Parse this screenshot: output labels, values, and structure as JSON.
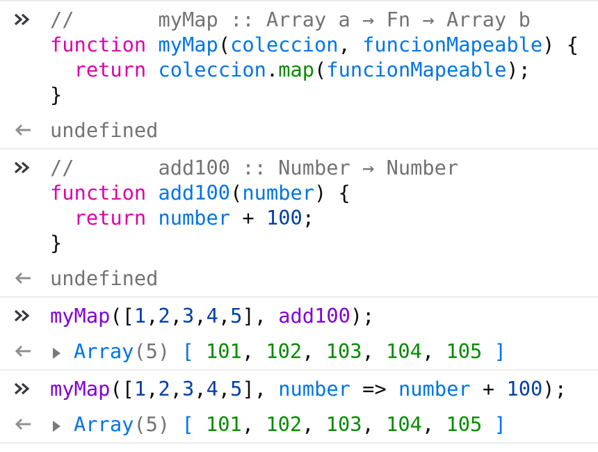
{
  "entries": [
    {
      "input": [
        [
          [
            "c-comment",
            "//       myMap :: Array a → Fn → Array b"
          ]
        ],
        [
          [
            "c-kw",
            "function"
          ],
          [
            "c-plain",
            " "
          ],
          [
            "c-fn",
            "myMap"
          ],
          [
            "c-plain",
            "("
          ],
          [
            "c-var",
            "coleccion"
          ],
          [
            "c-plain",
            ", "
          ],
          [
            "c-var",
            "funcionMapeable"
          ],
          [
            "c-plain",
            ") {"
          ]
        ],
        [
          [
            "c-plain",
            "  "
          ],
          [
            "c-kw",
            "return"
          ],
          [
            "c-plain",
            " "
          ],
          [
            "c-var",
            "coleccion"
          ],
          [
            "c-plain",
            "."
          ],
          [
            "c-prop",
            "map"
          ],
          [
            "c-plain",
            "("
          ],
          [
            "c-var",
            "funcionMapeable"
          ],
          [
            "c-plain",
            ");"
          ]
        ],
        [
          [
            "c-plain",
            "}"
          ]
        ]
      ],
      "output": {
        "type": "text",
        "text": "undefined"
      }
    },
    {
      "input": [
        [
          [
            "c-comment",
            "//       add100 :: Number → Number"
          ]
        ],
        [
          [
            "c-kw",
            "function"
          ],
          [
            "c-plain",
            " "
          ],
          [
            "c-fn",
            "add100"
          ],
          [
            "c-plain",
            "("
          ],
          [
            "c-var",
            "number"
          ],
          [
            "c-plain",
            ") {"
          ]
        ],
        [
          [
            "c-plain",
            "  "
          ],
          [
            "c-kw",
            "return"
          ],
          [
            "c-plain",
            " "
          ],
          [
            "c-var",
            "number"
          ],
          [
            "c-plain",
            " + "
          ],
          [
            "c-num",
            "100"
          ],
          [
            "c-plain",
            ";"
          ]
        ],
        [
          [
            "c-plain",
            "}"
          ]
        ]
      ],
      "output": {
        "type": "text",
        "text": "undefined"
      }
    },
    {
      "input": [
        [
          [
            "c-call",
            "myMap"
          ],
          [
            "c-plain",
            "(["
          ],
          [
            "c-num",
            "1"
          ],
          [
            "c-plain",
            ","
          ],
          [
            "c-num",
            "2"
          ],
          [
            "c-plain",
            ","
          ],
          [
            "c-num",
            "3"
          ],
          [
            "c-plain",
            ","
          ],
          [
            "c-num",
            "4"
          ],
          [
            "c-plain",
            ","
          ],
          [
            "c-num",
            "5"
          ],
          [
            "c-plain",
            "], "
          ],
          [
            "c-call",
            "add100"
          ],
          [
            "c-plain",
            ");"
          ]
        ]
      ],
      "output": {
        "type": "array",
        "label": "Array",
        "length": "(5)",
        "values": [
          "101",
          "102",
          "103",
          "104",
          "105"
        ]
      }
    },
    {
      "input": [
        [
          [
            "c-call",
            "myMap"
          ],
          [
            "c-plain",
            "(["
          ],
          [
            "c-num",
            "1"
          ],
          [
            "c-plain",
            ","
          ],
          [
            "c-num",
            "2"
          ],
          [
            "c-plain",
            ","
          ],
          [
            "c-num",
            "3"
          ],
          [
            "c-plain",
            ","
          ],
          [
            "c-num",
            "4"
          ],
          [
            "c-plain",
            ","
          ],
          [
            "c-num",
            "5"
          ],
          [
            "c-plain",
            "], "
          ],
          [
            "c-var",
            "number"
          ],
          [
            "c-plain",
            " => "
          ],
          [
            "c-var",
            "number"
          ],
          [
            "c-plain",
            " + "
          ],
          [
            "c-num",
            "100"
          ],
          [
            "c-plain",
            ");"
          ]
        ]
      ],
      "output": {
        "type": "array",
        "label": "Array",
        "length": "(5)",
        "values": [
          "101",
          "102",
          "103",
          "104",
          "105"
        ]
      }
    }
  ],
  "icons": {
    "input": "chevrons-right-icon",
    "output": "arrow-left-icon"
  }
}
